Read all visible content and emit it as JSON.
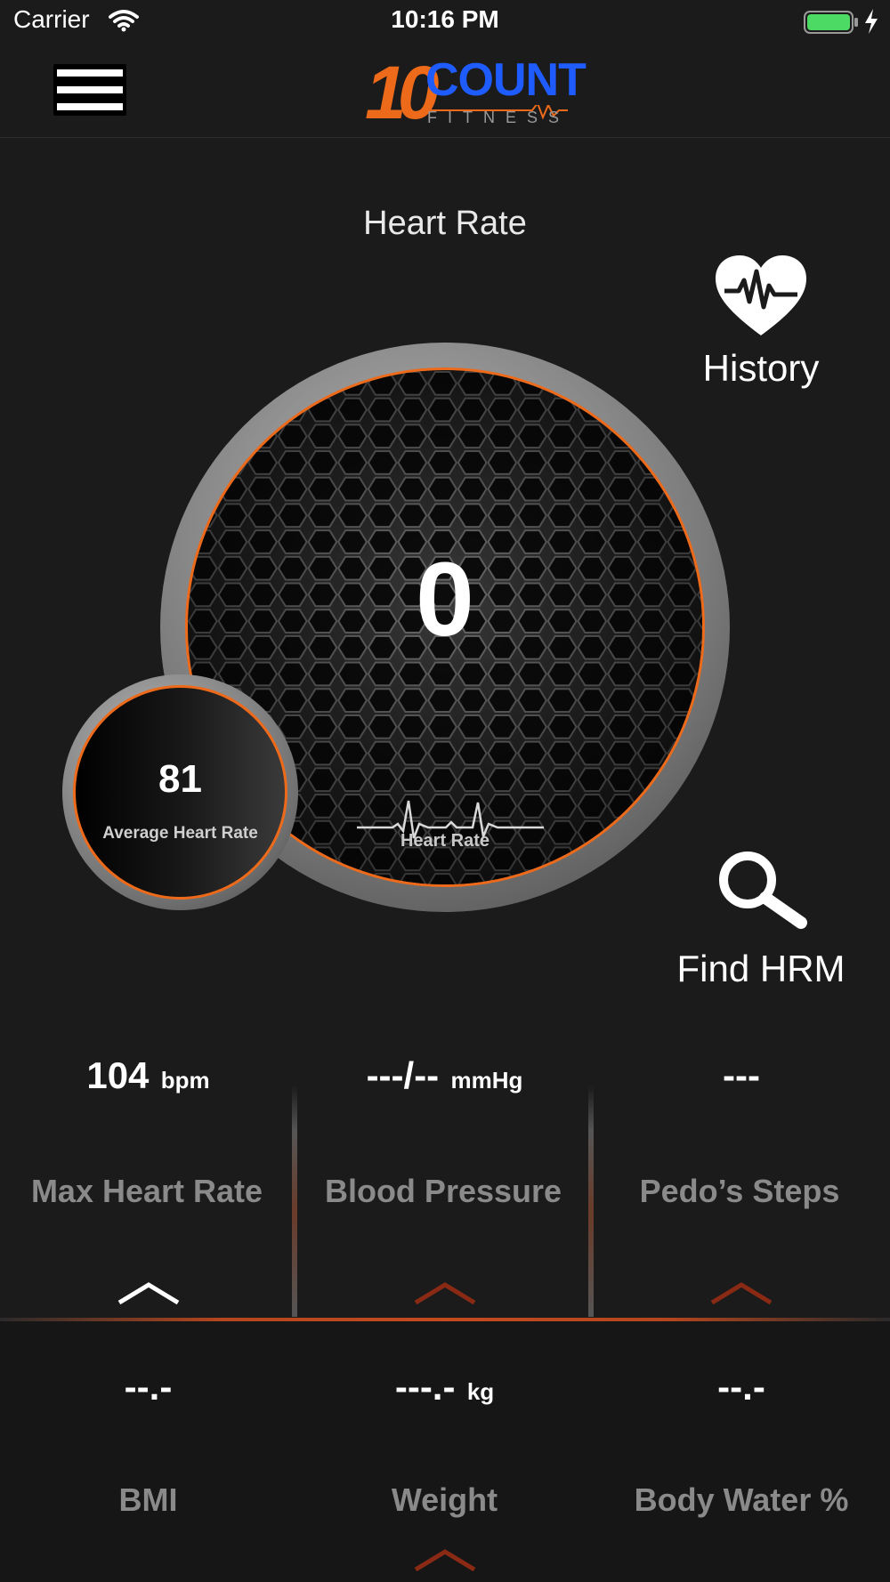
{
  "status_bar": {
    "carrier": "Carrier",
    "time": "10:16 PM"
  },
  "header": {
    "logo_number": "10",
    "logo_word": "COUNT",
    "logo_sub": "FITNESS",
    "brand_colors": {
      "orange": "#ee6a1b",
      "blue": "#1f5cff"
    }
  },
  "page": {
    "title": "Heart Rate"
  },
  "actions": {
    "history_label": "History",
    "find_label": "Find HRM"
  },
  "dial": {
    "value": "0",
    "label": "Heart Rate"
  },
  "average": {
    "value": "81",
    "label": "Average Heart Rate"
  },
  "metrics_top": [
    {
      "value": "104",
      "unit": "bpm",
      "label": "Max Heart Rate"
    },
    {
      "value": "---/--",
      "unit": "mmHg",
      "label": "Blood Pressure"
    },
    {
      "value": "---",
      "unit": "",
      "label": "Pedo’s Steps"
    }
  ],
  "metrics_bottom": [
    {
      "value": "--.-",
      "unit": "",
      "label": "BMI"
    },
    {
      "value": "---.-",
      "unit": "kg",
      "label": "Weight"
    },
    {
      "value": "--.-",
      "unit": "",
      "label": "Body Water %"
    }
  ],
  "icons": {
    "menu": "hamburger-icon",
    "history": "heart-ecg-icon",
    "find": "magnifier-icon",
    "chevron": "chevron-up-icon"
  },
  "accent_color": "#ee6a1b"
}
